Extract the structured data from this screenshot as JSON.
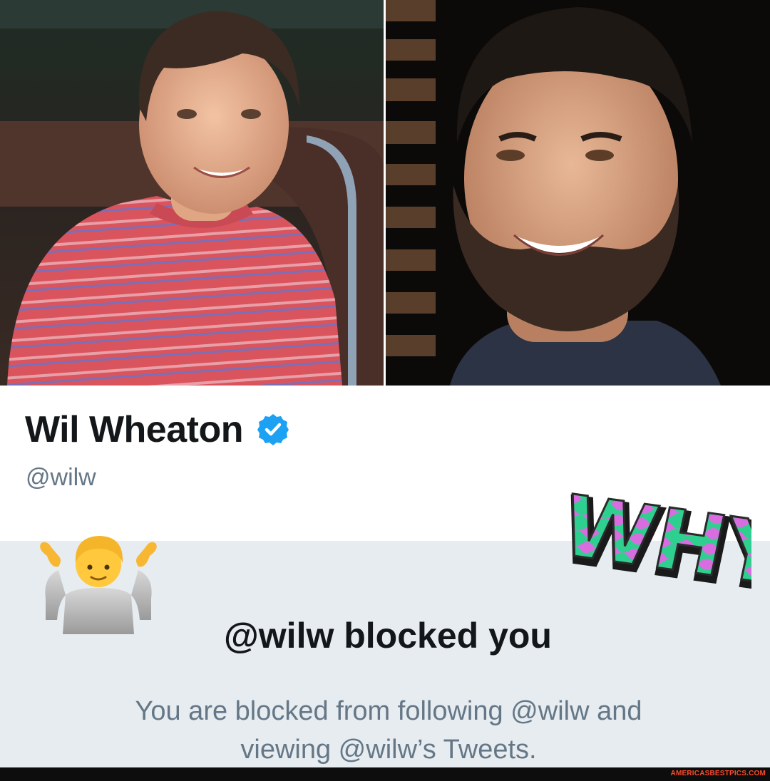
{
  "profile": {
    "name": "Wil Wheaton",
    "handle": "@wilw",
    "verified_badge_icon": "verified-check-icon",
    "verified_color": "#1da1f2"
  },
  "photos": {
    "left_icon": "child-portrait-photo",
    "right_icon": "adult-portrait-photo"
  },
  "block_notice": {
    "title": "@wilw blocked you",
    "line1": "You are blocked from following @wilw and",
    "line2": "viewing @wilw’s Tweets.",
    "emoji_icon": "person-shrugging-icon"
  },
  "sticker": {
    "text": "WHY?"
  },
  "watermark": "AMERICASBESTPICS.COM",
  "colors": {
    "notice_background": "#e6ecf0",
    "name_text": "#14171a",
    "secondary_text": "#657786"
  }
}
